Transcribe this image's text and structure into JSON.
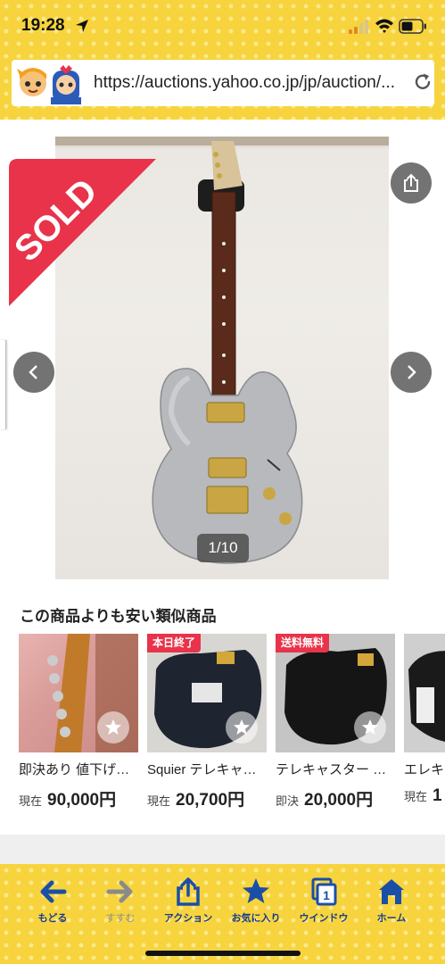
{
  "status_bar": {
    "time": "19:28"
  },
  "address_bar": {
    "url": "https://auctions.yahoo.co.jp/jp/auction/..."
  },
  "gallery": {
    "sold_label": "SOLD",
    "counter": "1/10"
  },
  "similar": {
    "title": "この商品よりも安い類似商品",
    "items": [
      {
        "tag": "",
        "title": "即決あり 値下げ交渉可",
        "price_label": "現在",
        "price": "90,000円"
      },
      {
        "tag": "本日終了",
        "title": "Squier テレキャスター",
        "price_label": "現在",
        "price": "20,700円"
      },
      {
        "tag": "送料無料",
        "title": "テレキャスター ボディ",
        "price_label": "即決",
        "price": "20,000円"
      },
      {
        "tag": "",
        "title": "エレキ",
        "price_label": "現在",
        "price": "1"
      }
    ]
  },
  "toolbar": {
    "back": "もどる",
    "forward": "すすむ",
    "action": "アクション",
    "favorites": "お気に入り",
    "window": "ウインドウ",
    "window_count": "1",
    "home": "ホーム"
  },
  "colors": {
    "accent_yellow": "#f7d43e",
    "nav_blue": "#1a4fa8",
    "sold_red": "#e8334a"
  }
}
